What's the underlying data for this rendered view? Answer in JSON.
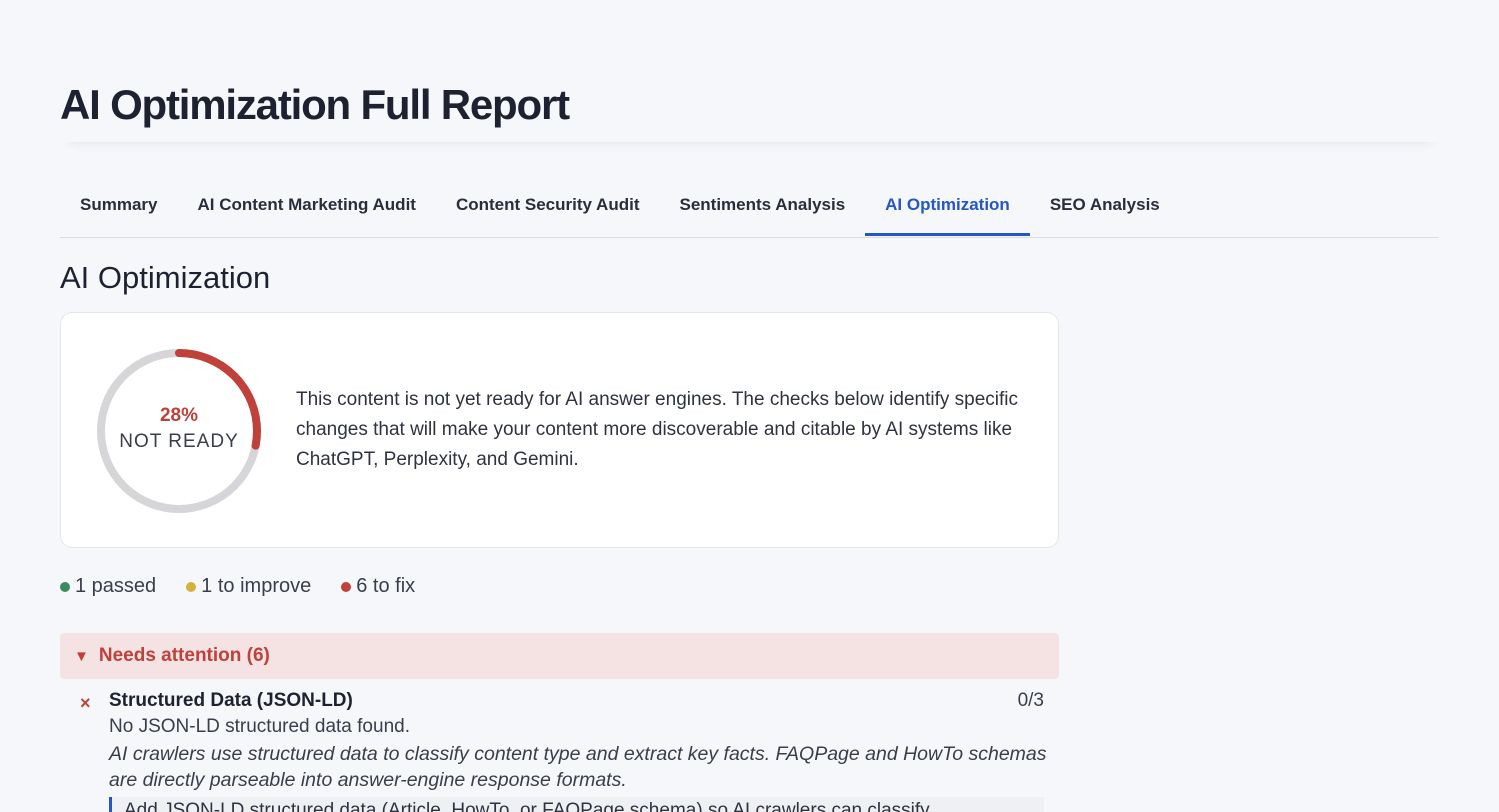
{
  "report": {
    "title": "AI Optimization Full Report"
  },
  "tabs": [
    {
      "label": "Summary",
      "active": false
    },
    {
      "label": "AI Content Marketing Audit",
      "active": false
    },
    {
      "label": "Content Security Audit",
      "active": false
    },
    {
      "label": "Sentiments Analysis",
      "active": false
    },
    {
      "label": "AI Optimization",
      "active": true
    },
    {
      "label": "SEO Analysis",
      "active": false
    }
  ],
  "section": {
    "title": "AI Optimization"
  },
  "score": {
    "percent_label": "28%",
    "percent_value": 28,
    "status": "NOT READY",
    "description": "This content is not yet ready for AI answer engines. The checks below identi­fy specific changes that will make your content more discoverable and citable by AI systems like ChatGPT, Perplexity, and Gemini.",
    "color": "#c0403a"
  },
  "legend": {
    "passed": {
      "label": "1 passed",
      "color": "#3a8a5f"
    },
    "improve": {
      "label": "1 to improve",
      "color": "#d4b13a"
    },
    "fix": {
      "label": "6 to fix",
      "color": "#c0403a"
    }
  },
  "attention": {
    "label": "Needs attention (6)",
    "caret": "▼",
    "background": "#f5e3e3"
  },
  "checks": [
    {
      "icon": "×",
      "title": "Structured Data (JSON-LD)",
      "score": "0/3",
      "finding": "No JSON-LD structured data found.",
      "explanation": "AI crawlers use structured data to classify content type and extract key facts. FAQPage and HowTo schemas are directly parseable into answer-engine response formats.",
      "recommendation": "Add JSON-LD structured data (Article, HowTo, or FAQPage schema) so AI crawlers can classify"
    }
  ],
  "colors": {
    "accent": "#2456c8",
    "danger": "#c0403a",
    "gauge_track": "#d6d6d9"
  }
}
